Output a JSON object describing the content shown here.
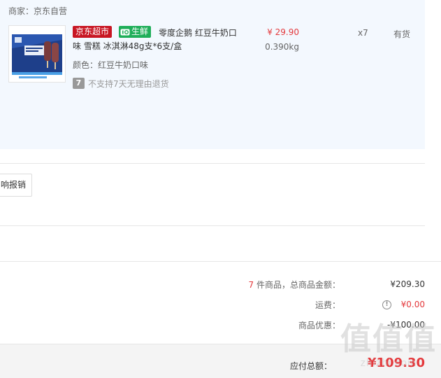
{
  "shop": {
    "label": "商家：京东自营"
  },
  "product": {
    "image_icon": "popsicle-box-image",
    "tag_jd": "京东超市",
    "tag_fresh": "生鲜",
    "title_line1": "零度企鹅 红豆牛奶口",
    "title_line2": "味 雪糕 冰淇淋48g支*6支/盒",
    "color": "颜色：红豆牛奶口味",
    "return_badge": "7",
    "return_policy": "不支持7天无理由退货",
    "price": "¥ 29.90",
    "weight": "0.390kg",
    "quantity": "x7",
    "stock": "有货"
  },
  "invoice": {
    "button_label": "响报销"
  },
  "summary": {
    "count": "7",
    "goods_total_label": " 件商品，总商品金额：",
    "goods_total_value": "¥209.30",
    "shipping_label": "运费：",
    "shipping_value": "¥0.00",
    "discount_label": "商品优惠：",
    "discount_value": "-¥100.00",
    "payable_label": "应付总额：",
    "payable_value": "¥109.30"
  },
  "watermark": {
    "logo": "值值值",
    "url": "zhizhi.com"
  },
  "colors": {
    "accent_red": "#e4393c",
    "jd_red": "#c81623",
    "fresh_green": "#1fae59",
    "panel_bg": "#f3f8fe"
  }
}
